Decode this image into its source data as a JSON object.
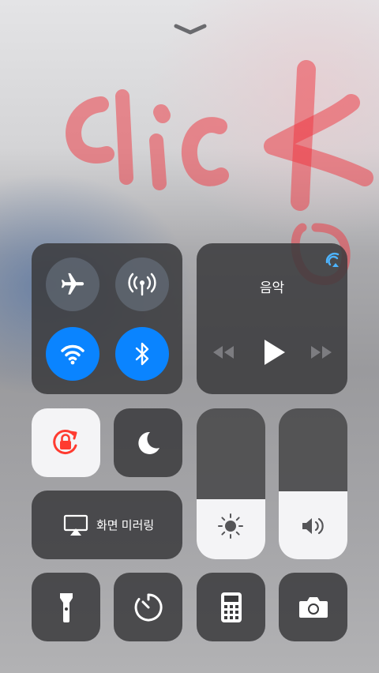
{
  "connectivity": {
    "airplane_icon": "airplane-icon",
    "cellular_icon": "cellular-antenna-icon",
    "wifi_icon": "wifi-icon",
    "bluetooth_icon": "bluetooth-icon"
  },
  "music": {
    "title": "음악",
    "airplay_icon": "airplay-audio-icon",
    "controls": [
      "rewind-icon",
      "play-icon",
      "fast-forward-icon"
    ]
  },
  "orientation_lock": {
    "icon": "orientation-lock-icon",
    "active": true
  },
  "do_not_disturb": {
    "icon": "moon-icon",
    "active": false
  },
  "screen_mirroring": {
    "label": "화면 미러링",
    "icon": "screen-mirroring-icon"
  },
  "brightness": {
    "icon": "sun-icon",
    "level": 0.4
  },
  "volume": {
    "icon": "speaker-icon",
    "level": 0.45
  },
  "shortcuts": [
    "flashlight-icon",
    "timer-icon",
    "calculator-icon",
    "camera-icon"
  ],
  "annotation": {
    "text": "click"
  },
  "colors": {
    "blue": "#0a84ff",
    "red": "#ff3b30",
    "tile": "#3a3a3c",
    "active_tile": "#f4f4f6"
  }
}
